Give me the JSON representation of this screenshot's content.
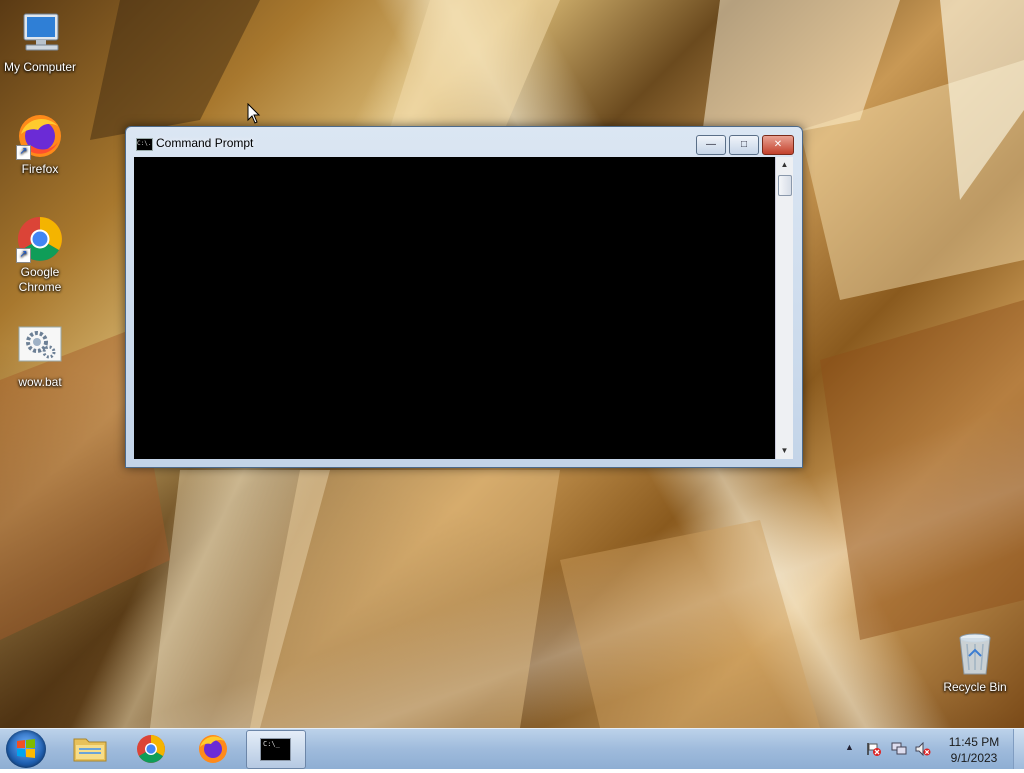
{
  "desktop": {
    "icons": [
      {
        "label": "My Computer",
        "icon": "my-computer-icon"
      },
      {
        "label": "Firefox",
        "icon": "firefox-icon"
      },
      {
        "label": "Google Chrome",
        "icon": "chrome-icon"
      },
      {
        "label": "wow.bat",
        "icon": "batch-file-gear-icon"
      },
      {
        "label": "Recycle Bin",
        "icon": "recycle-bin-icon"
      }
    ]
  },
  "window": {
    "title": "Command Prompt",
    "title_icon_text": "C:\\.",
    "minimize_glyph": "—",
    "maximize_glyph": "□",
    "close_glyph": "✕",
    "console_bg": "#000000",
    "scroll_up": "▲",
    "scroll_down": "▼"
  },
  "taskbar": {
    "pinned": [
      "windows-explorer-icon",
      "chrome-icon",
      "firefox-icon",
      "command-prompt-icon"
    ],
    "active_item_text": "C:\\_",
    "tray": {
      "overflow_glyph": "▲",
      "time": "11:45 PM",
      "date": "9/1/2023"
    }
  },
  "colors": {
    "taskbar": "#9fbbdc",
    "close_button": "#c3412c",
    "window_frame": "#c3d4e8"
  }
}
